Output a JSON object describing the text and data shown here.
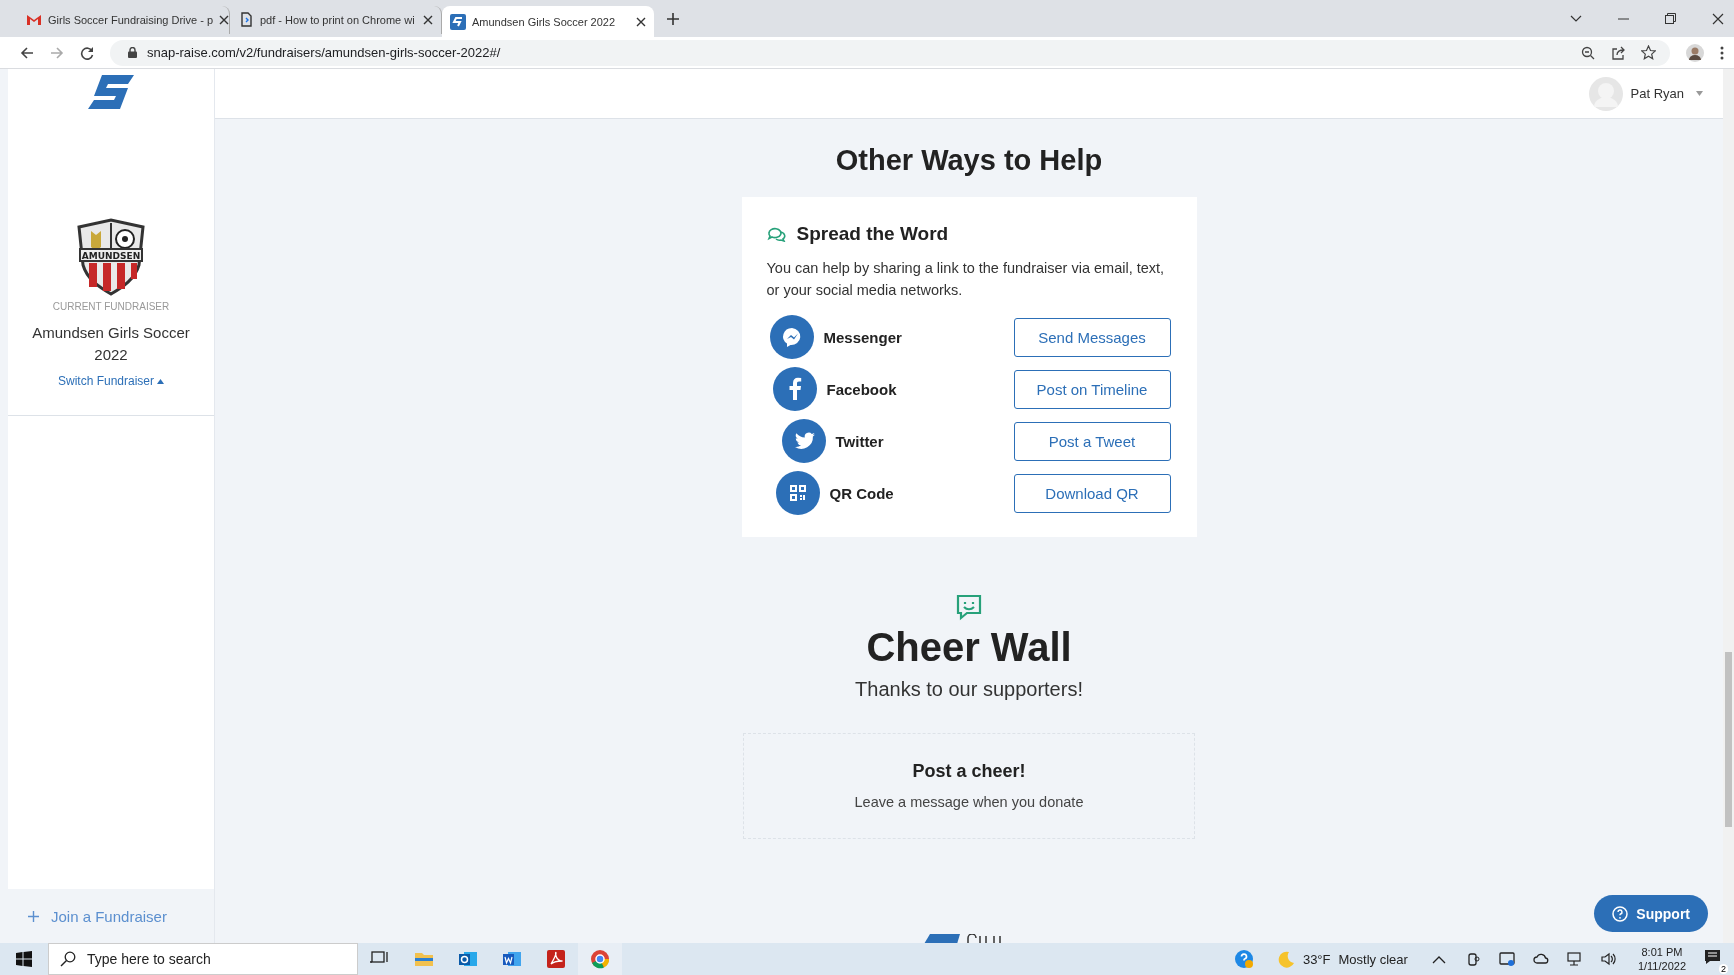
{
  "browser": {
    "tabs": [
      {
        "kind": "gmail",
        "title": "Girls Soccer Fundraising Drive - p",
        "selected": false
      },
      {
        "kind": "doc",
        "title": "pdf - How to print on Chrome wi",
        "selected": false
      },
      {
        "kind": "snap",
        "title": "Amundsen Girls Soccer 2022",
        "selected": true
      }
    ],
    "url": "snap-raise.com/v2/fundraisers/amundsen-girls-soccer-2022#/"
  },
  "sidebar": {
    "crest_text": "AMUNDSEN",
    "label": "CURRENT FUNDRAISER",
    "fundraiser": "Amundsen Girls Soccer 2022",
    "switch_link": "Switch Fundraiser",
    "join": "Join a Fundraiser"
  },
  "header": {
    "user": "Pat Ryan"
  },
  "help": {
    "title": "Other Ways to Help",
    "card": {
      "title": "Spread the Word",
      "description": "You can help by sharing a link to the fundraiser via email, text, or your social media networks.",
      "channels": [
        {
          "kind": "messenger",
          "name": "Messenger",
          "action": "Send Messages"
        },
        {
          "kind": "facebook",
          "name": "Facebook",
          "action": "Post on Timeline"
        },
        {
          "kind": "twitter",
          "name": "Twitter",
          "action": "Post a Tweet"
        },
        {
          "kind": "qr",
          "name": "QR Code",
          "action": "Download QR"
        }
      ]
    }
  },
  "cheer_wall": {
    "title": "Cheer Wall",
    "subtitle": "Thanks to our supporters!",
    "post": {
      "title": "Post a cheer!",
      "hint": "Leave a message when you donate"
    }
  },
  "support_button": "Support",
  "taskbar": {
    "search_placeholder": "Type here to search",
    "temperature": "33°F",
    "weather": "Mostly clear",
    "time": "8:01 PM",
    "date": "1/11/2022",
    "notifications": "2"
  }
}
